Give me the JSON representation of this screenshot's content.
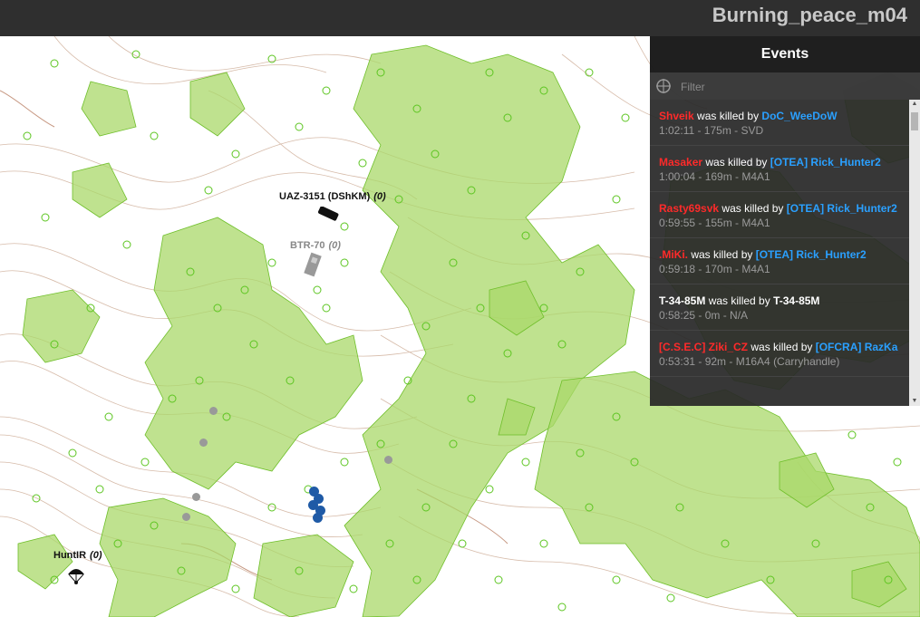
{
  "header": {
    "mission_title": "Burning_peace_m04"
  },
  "events": {
    "title": "Events",
    "filter_placeholder": "Filter",
    "items": [
      {
        "victim": "Shveik",
        "victim_color": "#ff2a2a",
        "verb": " was killed by ",
        "killer": "DoC_WeeDoW",
        "killer_color": "#2aa0ff",
        "meta": "1:02:11 - 175m - SVD"
      },
      {
        "victim": "Masaker",
        "victim_color": "#ff2a2a",
        "verb": " was killed by ",
        "killer": "[OTEA] Rick_Hunter2",
        "killer_color": "#2aa0ff",
        "meta": "1:00:04 - 169m - M4A1"
      },
      {
        "victim": "Rasty69svk",
        "victim_color": "#ff2a2a",
        "verb": " was killed by ",
        "killer": "[OTEA] Rick_Hunter2",
        "killer_color": "#2aa0ff",
        "meta": "0:59:55 - 155m - M4A1"
      },
      {
        "victim": ".MiKi.",
        "victim_color": "#ff2a2a",
        "verb": " was killed by ",
        "killer": "[OTEA] Rick_Hunter2",
        "killer_color": "#2aa0ff",
        "meta": "0:59:18 - 170m - M4A1"
      },
      {
        "victim": "T-34-85M",
        "victim_color": "#ffffff",
        "verb": " was killed by ",
        "killer": "T-34-85M",
        "killer_color": "#ffffff",
        "meta": "0:58:25 - 0m - N/A"
      },
      {
        "victim": "[C.S.E.C] Ziki_CZ",
        "victim_color": "#ff2a2a",
        "verb": " was killed by ",
        "killer": "[OFCRA] RazKa",
        "killer_color": "#2aa0ff",
        "meta": "0:53:31 - 92m - M16A4 (Carryhandle)"
      }
    ]
  },
  "map_units": {
    "uaz": {
      "name": "UAZ-3151 (DShKM)",
      "count": "(0)",
      "icon": "vehicle-icon"
    },
    "btr": {
      "name": "BTR-70",
      "count": "(0)",
      "icon": "apc-icon"
    },
    "huntir": {
      "name": "HuntIR",
      "count": "(0)",
      "icon": "parachute-icon"
    }
  },
  "colors": {
    "forest": "#a9d86a",
    "forest_stroke": "#6fbf2a",
    "contour": "#c9a88f",
    "friendly": "#1f5aa6",
    "dead": "#999999"
  }
}
